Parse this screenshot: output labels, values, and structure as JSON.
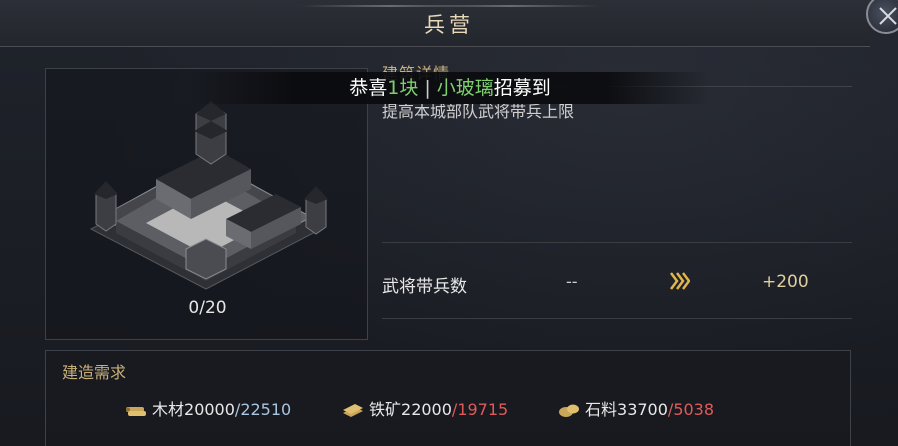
{
  "window": {
    "title": "兵营"
  },
  "building": {
    "progress": "0/20"
  },
  "details": {
    "title": "建筑详情",
    "description": "提高本城部队武将带兵上限"
  },
  "toast": {
    "prefix": "恭喜",
    "item": "1块",
    "separator": "|",
    "name": "小玻璃",
    "suffix": "招募到"
  },
  "stat": {
    "label": "武将带兵数",
    "current": "--",
    "next": "+200"
  },
  "requirements": {
    "title": "建造需求",
    "items": [
      {
        "name": "木材",
        "need": "20000",
        "have": "/22510",
        "enough": true
      },
      {
        "name": "铁矿",
        "need": "22000",
        "have": "/19715",
        "enough": false
      },
      {
        "name": "石料",
        "need": "33700",
        "have": "/5038",
        "enough": false
      }
    ]
  },
  "colors": {
    "accent_gold": "#c9b07a",
    "insufficient": "#e05a5a",
    "highlight_green": "#7fcf6f"
  }
}
